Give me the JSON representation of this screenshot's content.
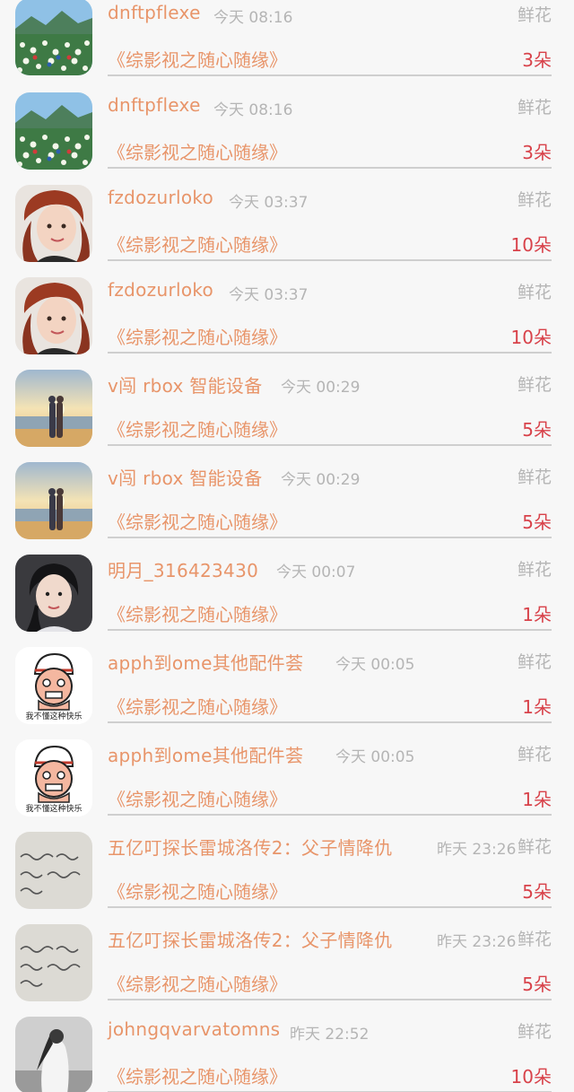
{
  "items": [
    {
      "avatar": "landscape-flowers",
      "name": "dnftpflexe",
      "time": "今天 08:16",
      "gift": "鲜花",
      "title": "《综影视之随心随缘》",
      "count": "3朵"
    },
    {
      "avatar": "landscape-flowers",
      "name": "dnftpflexe",
      "time": "今天 08:16",
      "gift": "鲜花",
      "title": "《综影视之随心随缘》",
      "count": "3朵"
    },
    {
      "avatar": "woman-red-hair",
      "name": "fzdozurloko",
      "time": "今天 03:37",
      "gift": "鲜花",
      "title": "《综影视之随心随缘》",
      "count": "10朵"
    },
    {
      "avatar": "woman-red-hair",
      "name": "fzdozurloko",
      "time": "今天 03:37",
      "gift": "鲜花",
      "title": "《综影视之随心随缘》",
      "count": "10朵"
    },
    {
      "avatar": "couple-sunset",
      "name": "v闯 rbox 智能设备",
      "time": "今天 00:29",
      "gift": "鲜花",
      "title": "《综影视之随心随缘》",
      "count": "5朵"
    },
    {
      "avatar": "couple-sunset",
      "name": "v闯 rbox 智能设备",
      "time": "今天 00:29",
      "gift": "鲜花",
      "title": "《综影视之随心随缘》",
      "count": "5朵"
    },
    {
      "avatar": "girl-braid",
      "name": "明月_316423430",
      "time": "今天 00:07",
      "gift": "鲜花",
      "title": "《综影视之随心随缘》",
      "count": "1朵"
    },
    {
      "avatar": "cartoon-man",
      "avatar_caption": "我不懂这种快乐",
      "name": "apph到ome其他配件荟",
      "time": "今天 00:05",
      "gift": "鲜花",
      "title": "《综影视之随心随缘》",
      "count": "1朵"
    },
    {
      "avatar": "cartoon-man",
      "avatar_caption": "我不懂这种快乐",
      "name": "apph到ome其他配件荟",
      "time": "今天 00:05",
      "gift": "鲜花",
      "title": "《综影视之随心随缘》",
      "count": "1朵"
    },
    {
      "avatar": "handwriting",
      "name": "五亿叮探长雷城洛传2：父子情降仇",
      "time": "昨天 23:26",
      "gift": "鲜花",
      "title": "《综影视之随心随缘》",
      "count": "5朵"
    },
    {
      "avatar": "handwriting",
      "name": "五亿叮探长雷城洛传2：父子情降仇",
      "time": "昨天 23:26",
      "gift": "鲜花",
      "title": "《综影视之随心随缘》",
      "count": "5朵"
    },
    {
      "avatar": "bw-figure",
      "name": "johngqvarvatomns",
      "time": "昨天 22:52",
      "gift": "鲜花",
      "title": "《综影视之随心随缘》",
      "count": "10朵"
    }
  ],
  "colors": {
    "name": "#e8956a",
    "count": "#d8424a",
    "muted": "#b5b5b5",
    "background": "#f7f7f7",
    "divider": "#cfcfcf"
  }
}
